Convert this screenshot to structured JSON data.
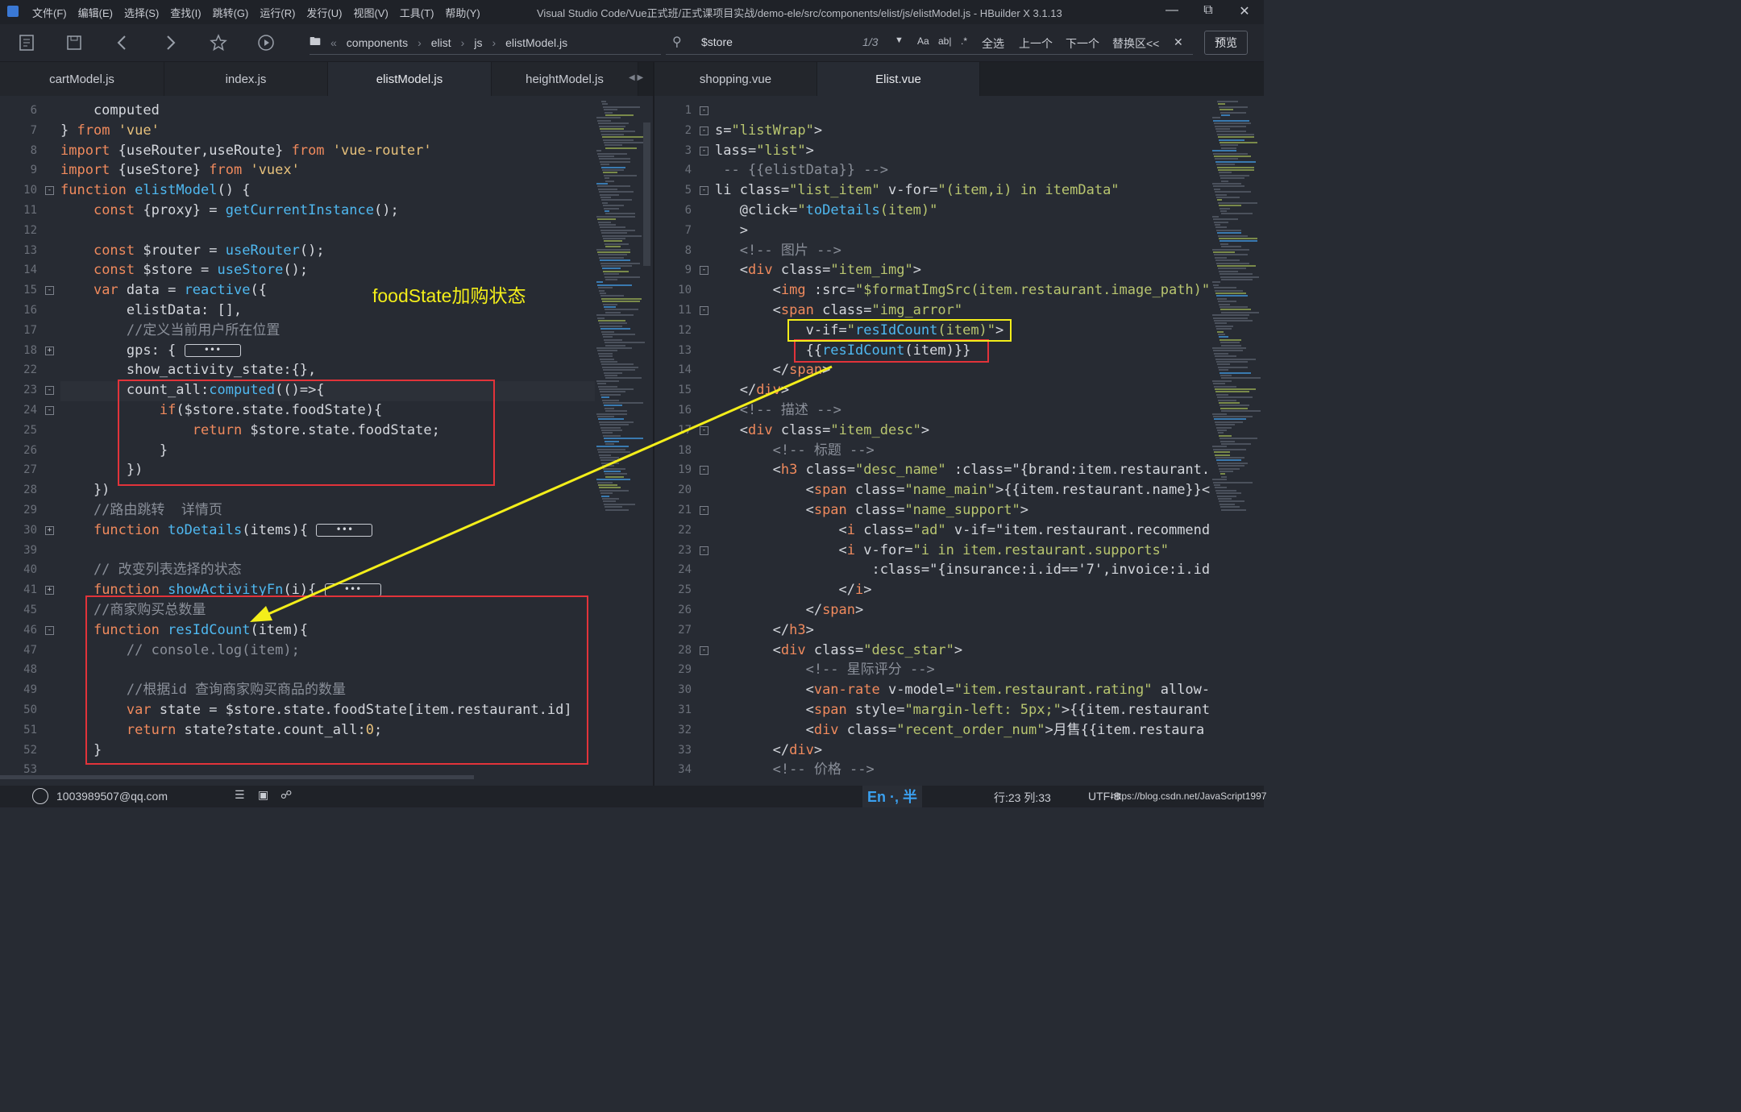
{
  "titlebar": {
    "menus": [
      "文件(F)",
      "编辑(E)",
      "选择(S)",
      "查找(I)",
      "跳转(G)",
      "运行(R)",
      "发行(U)",
      "视图(V)",
      "工具(T)",
      "帮助(Y)"
    ],
    "title": "Visual Studio Code/Vue正式班/正式课项目实战/demo-ele/src/components/elist/js/elistModel.js - HBuilder X 3.1.13"
  },
  "toolbar": {
    "breadcrumb": [
      "components",
      "elist",
      "js",
      "elistModel.js"
    ],
    "search_query": "$store",
    "match_count": "1/3",
    "opt_case": "Aa",
    "opt_word": "ab|",
    "opt_regex": ".*",
    "select_all": "全选",
    "prev": "上一个",
    "next": "下一个",
    "replace_toggle": "替换区<<",
    "preview": "预览"
  },
  "left_tabs": [
    "cartModel.js",
    "index.js",
    "elistModel.js",
    "heightModel.js"
  ],
  "right_tabs": [
    "shopping.vue",
    "Elist.vue"
  ],
  "annotation": "foodState加购状态",
  "status": {
    "user": "1003989507@qq.com",
    "ime": "En ·, 半",
    "position": "行:23  列:33",
    "encoding": "UTF-8",
    "watermark": "https://blog.csdn.net/JavaScript1997"
  },
  "left_lines": [
    "6",
    "7",
    "8",
    "9",
    "10",
    "11",
    "12",
    "13",
    "14",
    "15",
    "16",
    "17",
    "18",
    "22",
    "23",
    "24",
    "25",
    "26",
    "27",
    "28",
    "29",
    "30",
    "39",
    "40",
    "41",
    "45",
    "46",
    "47",
    "48",
    "49",
    "50",
    "51",
    "52",
    "53"
  ],
  "right_lines": [
    "1",
    "2",
    "3",
    "4",
    "5",
    "6",
    "7",
    "8",
    "9",
    "10",
    "11",
    "12",
    "13",
    "14",
    "15",
    "16",
    "17",
    "18",
    "19",
    "20",
    "21",
    "22",
    "23",
    "24",
    "25",
    "26",
    "27",
    "28",
    "29",
    "30",
    "31",
    "32",
    "33",
    "34"
  ],
  "left_code": [
    "    computed",
    "} from 'vue'",
    "import {useRouter,useRoute} from 'vue-router'",
    "import {useStore} from 'vuex'",
    "function elistModel() {",
    "    const {proxy} = getCurrentInstance();",
    "",
    "    const $router = useRouter();",
    "    const $store = useStore();",
    "    var data = reactive({",
    "        elistData: [],",
    "        //定义当前用户所在位置",
    "        gps: {",
    "        show_activity_state:{},",
    "        count_all:computed(()=>{",
    "            if($store.state.foodState){",
    "                return $store.state.foodState;",
    "            }",
    "        })",
    "    })",
    "    //路由跳转  详情页",
    "    function toDetails(items){",
    "",
    "    // 改变列表选择的状态",
    "    function showActivityFn(i){",
    "    //商家购买总数量",
    "    function resIdCount(item){",
    "        // console.log(item);",
    "",
    "        //根据id 查询商家购买商品的数量",
    "        var state = $store.state.foodState[item.restaurant.id]",
    "        return state?state.count_all:0;",
    "    }",
    ""
  ],
  "right_code": [
    "",
    "s=\"listWrap\">",
    "lass=\"list\">",
    " -- {{elistData}} -->",
    "li class=\"list_item\" v-for=\"(item,i) in itemData\"",
    "   @click=\"toDetails(item)\"",
    "   >",
    "   <!-- 图片 -->",
    "   <div class=\"item_img\">",
    "       <img :src=\"$formatImgSrc(item.restaurant.image_path)\"",
    "       <span class=\"img_arror\"",
    "           v-if=\"resIdCount(item)\">",
    "           {{resIdCount(item)}}",
    "       </span>",
    "   </div>",
    "   <!-- 描述 -->",
    "   <div class=\"item_desc\">",
    "       <!-- 标题 -->",
    "       <h3 class=\"desc_name\" :class=\"{brand:item.restaurant.",
    "           <span class=\"name_main\">{{item.restaurant.name}}<",
    "           <span class=\"name_support\">",
    "               <i class=\"ad\" v-if=\"item.restaurant.recommend",
    "               <i v-for=\"i in item.restaurant.supports\"",
    "                   :class=\"{insurance:i.id=='7',invoice:i.id",
    "               </i>",
    "           </span>",
    "       </h3>",
    "       <div class=\"desc_star\">",
    "           <!-- 星际评分 -->",
    "           <van-rate v-model=\"item.restaurant.rating\" allow-",
    "           <span style=\"margin-left: 5px;\">{{item.restaurant",
    "           <div class=\"recent_order_num\">月售{{item.restaura",
    "       </div>",
    "       <!-- 价格 -->"
  ]
}
